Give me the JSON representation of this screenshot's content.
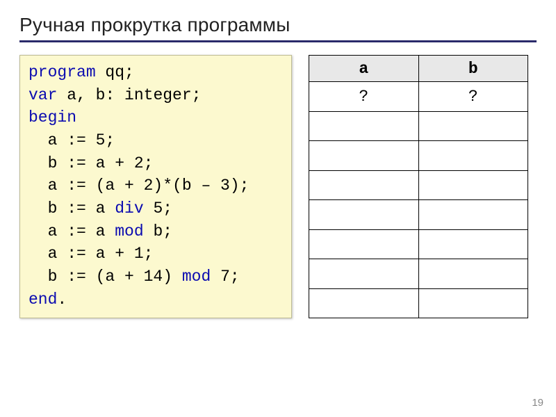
{
  "title": "Ручная прокрутка программы",
  "code": {
    "l1a": "program",
    "l1b": " qq;",
    "l2a": "var",
    "l2b": " a, b: integer;",
    "l3": "begin",
    "l4": "  a := 5;",
    "l5": "  b := a + 2;",
    "l6": "  a := (a + 2)*(b – 3);",
    "l7a": "  b := a ",
    "l7b": "div",
    "l7c": " 5;",
    "l8a": "  a := a ",
    "l8b": "mod",
    "l8c": " b;",
    "l9": "  a := a + 1;",
    "l10a": "  b := (a + 14) ",
    "l10b": "mod",
    "l10c": " 7;",
    "l11": "end",
    "l11b": "."
  },
  "table": {
    "headers": [
      "a",
      "b"
    ],
    "rows": [
      [
        "?",
        "?"
      ],
      [
        "",
        ""
      ],
      [
        "",
        ""
      ],
      [
        "",
        ""
      ],
      [
        "",
        ""
      ],
      [
        "",
        ""
      ],
      [
        "",
        ""
      ],
      [
        "",
        ""
      ]
    ]
  },
  "page_number": "19"
}
